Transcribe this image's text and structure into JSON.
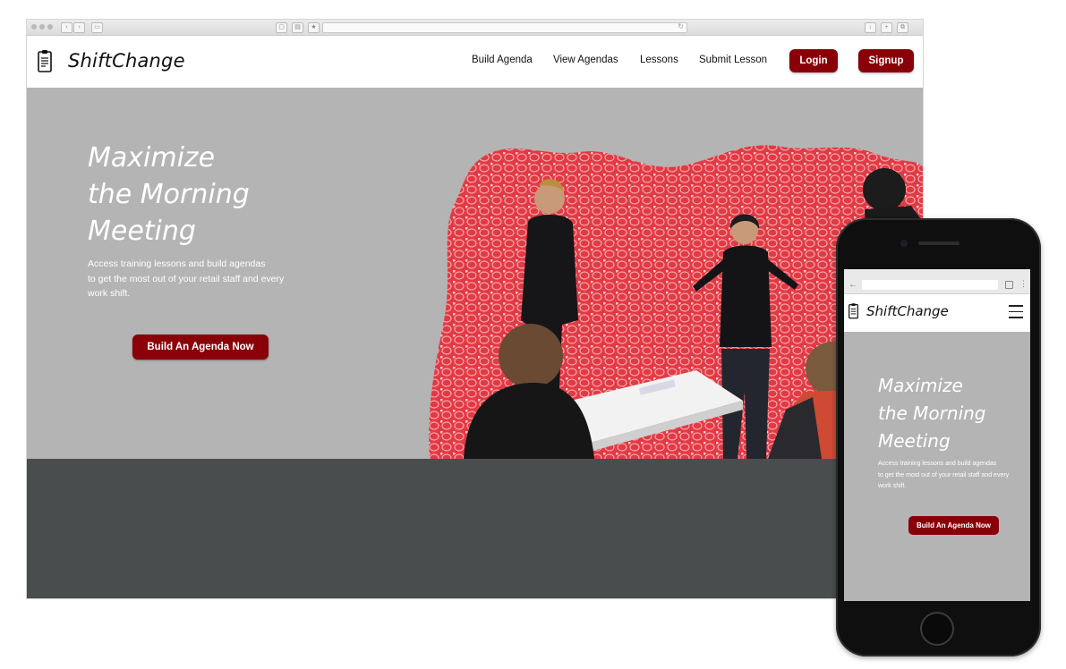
{
  "desktop": {
    "brand": "ShiftChange",
    "nav": {
      "links": [
        "Build Agenda",
        "View Agendas",
        "Lessons",
        "Submit Lesson"
      ],
      "login": "Login",
      "signup": "Signup"
    },
    "hero": {
      "title_lines": [
        "Maximize",
        "the Morning",
        "Meeting"
      ],
      "subtitle_lines": [
        "Access training lessons and build agendas",
        "to get the most out of your retail staff and every",
        "work shift."
      ],
      "cta": "Build An Agenda Now"
    }
  },
  "mobile": {
    "brand": "ShiftChange",
    "hero": {
      "title_lines": [
        "Maximize",
        "the Morning",
        "Meeting"
      ],
      "subtitle_lines": [
        "Access training lessons and build agendas",
        "to get the most out of your retail staff and every",
        "work shift."
      ],
      "cta": "Build An Agenda Now"
    }
  },
  "colors": {
    "accent": "#8a0008",
    "hero_bg": "#b4b4b4",
    "footer_bg": "#4a4d4e",
    "art_red": "#e23a44"
  },
  "icons": [
    "clipboard-icon",
    "hamburger-menu-icon",
    "back-arrow-icon",
    "tabs-icon",
    "more-vert-icon"
  ]
}
